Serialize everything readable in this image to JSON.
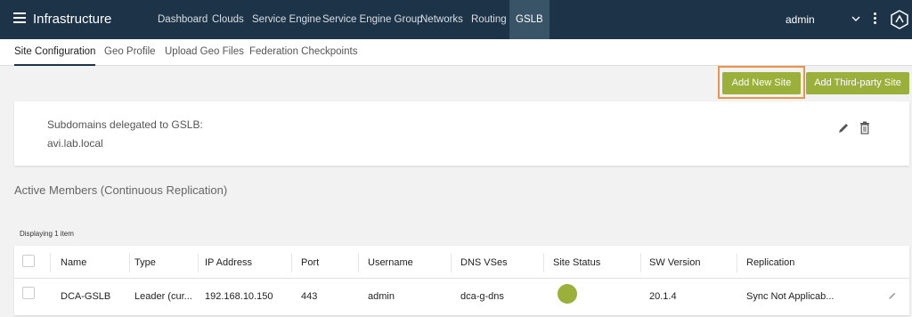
{
  "header": {
    "app_title": "Infrastructure",
    "nav": [
      "Dashboard",
      "Clouds",
      "Service Engine",
      "Service Engine Group",
      "Networks",
      "Routing",
      "GSLB"
    ],
    "active_nav": "GSLB",
    "user": "admin"
  },
  "subtabs": [
    "Site Configuration",
    "Geo Profile",
    "Upload Geo Files",
    "Federation Checkpoints"
  ],
  "actions": {
    "add_new_site": "Add New Site",
    "add_third_party_site": "Add Third-party Site"
  },
  "subdomains": {
    "label": "Subdomains delegated to GSLB:",
    "value": "avi.lab.local"
  },
  "section_title": "Active Members (Continuous Replication)",
  "table": {
    "displaying": "Displaying 1 item",
    "columns": [
      "Name",
      "Type",
      "IP Address",
      "Port",
      "Username",
      "DNS VSes",
      "Site Status",
      "SW Version",
      "Replication"
    ],
    "rows": [
      {
        "name": "DCA-GSLB",
        "type": "Leader (cur...",
        "ip": "192.168.10.150",
        "port": "443",
        "username": "admin",
        "dns_vses": "dca-g-dns",
        "site_status_color": "#9bb03a",
        "sw_version": "20.1.4",
        "replication": "Sync Not Applicab..."
      }
    ]
  },
  "colors": {
    "nav_bg": "#1d3448",
    "accent_green": "#9bb03a",
    "highlight_orange": "#e9944a"
  }
}
